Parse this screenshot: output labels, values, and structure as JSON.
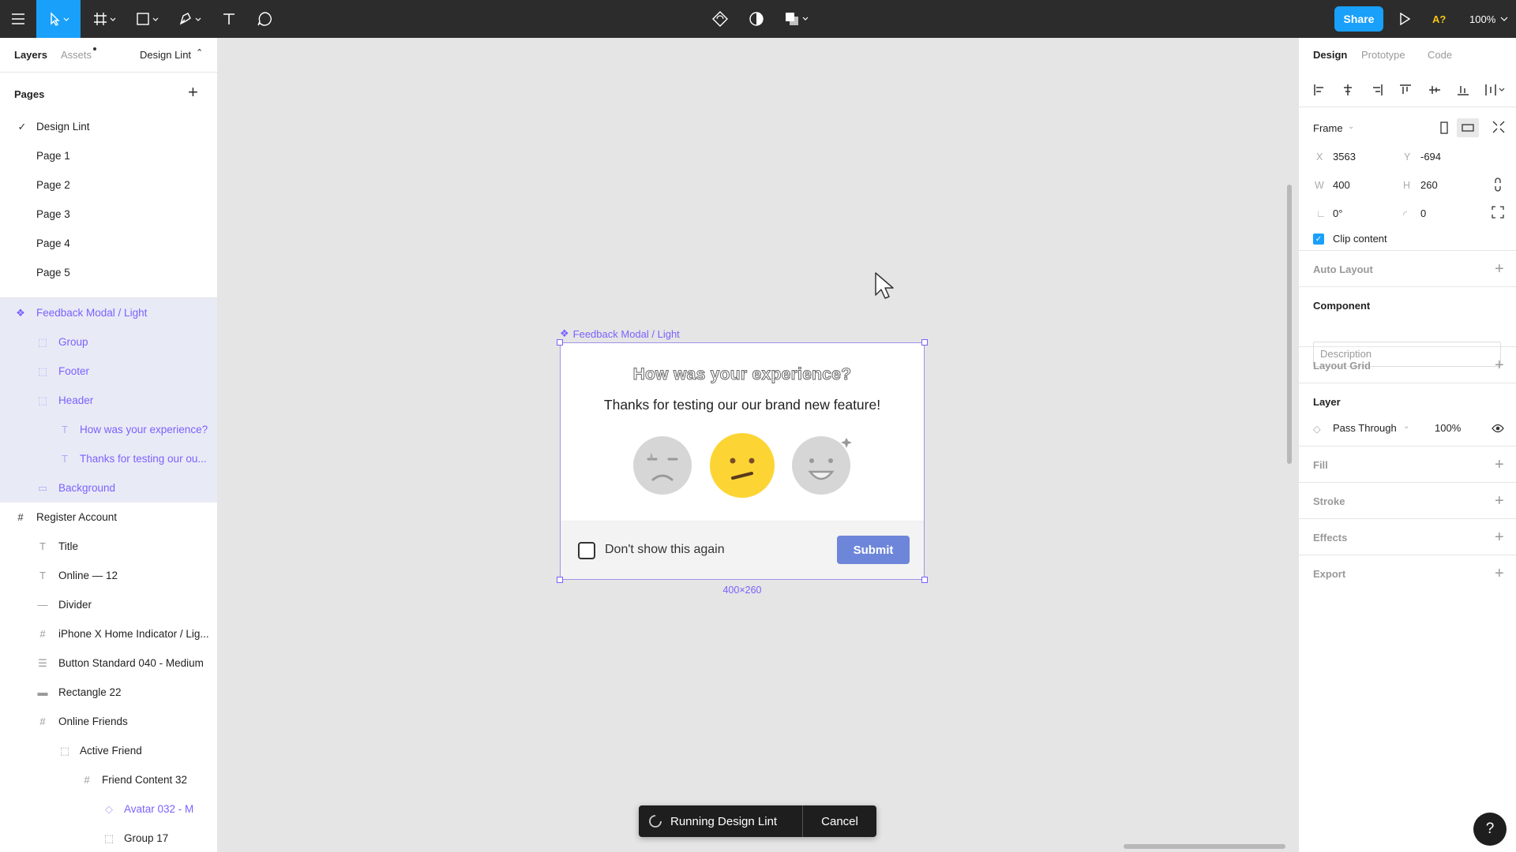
{
  "toolbar": {
    "share_label": "Share",
    "zoom": "100%",
    "user_initials": "A?"
  },
  "left": {
    "tabs": {
      "layers": "Layers",
      "assets": "Assets",
      "page_dropdown": "Design Lint"
    },
    "pages_title": "Pages",
    "pages": [
      "Design Lint",
      "Page 1",
      "Page 2",
      "Page 3",
      "Page 4",
      "Page 5"
    ],
    "layers": [
      {
        "label": "Feedback Modal / Light"
      },
      {
        "label": "Group"
      },
      {
        "label": "Footer"
      },
      {
        "label": "Header"
      },
      {
        "label": "How was your experience?"
      },
      {
        "label": "Thanks for testing our ou..."
      },
      {
        "label": "Background"
      },
      {
        "label": "Register Account"
      },
      {
        "label": "Title"
      },
      {
        "label": "Online — 12"
      },
      {
        "label": "Divider"
      },
      {
        "label": "iPhone X Home Indicator / Lig..."
      },
      {
        "label": "Button Standard 040 - Medium"
      },
      {
        "label": "Rectangle 22"
      },
      {
        "label": "Online Friends"
      },
      {
        "label": "Active Friend"
      },
      {
        "label": "Friend Content 32"
      },
      {
        "label": "Avatar 032 - M"
      },
      {
        "label": "Group 17"
      }
    ]
  },
  "canvas": {
    "frame_label": "Feedback Modal / Light",
    "modal_title": "How was your experience?",
    "modal_subtitle": "Thanks for testing our our brand new feature!",
    "checkbox_label": "Don't show this again",
    "submit_label": "Submit",
    "dimensions": "400×260",
    "lint_status": "Running Design Lint",
    "lint_cancel": "Cancel"
  },
  "right": {
    "tabs": {
      "design": "Design",
      "prototype": "Prototype",
      "code": "Code"
    },
    "frame_label": "Frame",
    "x_label": "X",
    "x": "3563",
    "y_label": "Y",
    "y": "-694",
    "w_label": "W",
    "w": "400",
    "h_label": "H",
    "h": "260",
    "rotation": "0°",
    "radius": "0",
    "clip_content": "Clip content",
    "auto_layout": "Auto Layout",
    "component": "Component",
    "description_placeholder": "Description",
    "layout_grid": "Layout Grid",
    "layer": "Layer",
    "blend_mode": "Pass Through",
    "opacity": "100%",
    "fill": "Fill",
    "stroke": "Stroke",
    "effects": "Effects",
    "export": "Export"
  },
  "help": "?"
}
